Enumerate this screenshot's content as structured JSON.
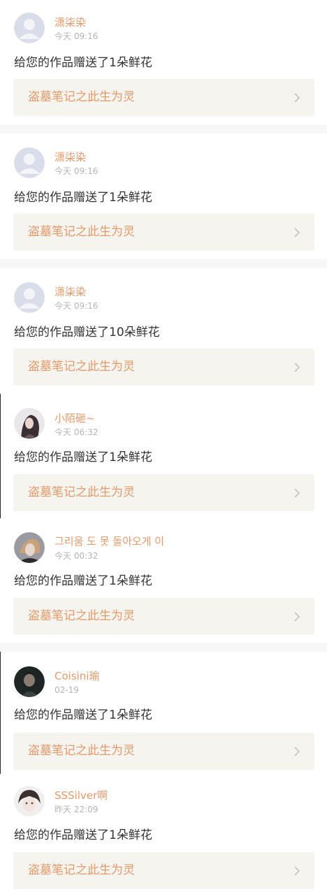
{
  "feed": [
    {
      "user": "潇柒染",
      "time": "今天 09:16",
      "message": "给您的作品赠送了1朵鲜花",
      "work_title": "盗墓笔记之此生为灵",
      "avatar": "default-avatar-icon"
    },
    {
      "user": "潇柒染",
      "time": "今天 09:16",
      "message": "给您的作品赠送了1朵鲜花",
      "work_title": "盗墓笔记之此生为灵",
      "avatar": "default-avatar-icon"
    },
    {
      "user": "潇柒染",
      "time": "今天 09:16",
      "message": "给您的作品赠送了10朵鲜花",
      "work_title": "盗墓笔记之此生为灵",
      "avatar": "default-avatar-icon"
    },
    {
      "user": "小陌砸~",
      "time": "今天 06:32",
      "message": "给您的作品赠送了1朵鲜花",
      "work_title": "盗墓笔记之此生为灵",
      "avatar": "user-photo"
    },
    {
      "user": "그리움 도 못 돌아오게 이",
      "time": "今天 00:32",
      "message": "给您的作品赠送了1朵鲜花",
      "work_title": "盗墓笔记之此生为灵",
      "avatar": "user-photo"
    },
    {
      "user": "Coisini瑜",
      "time": "02-19",
      "message": "给您的作品赠送了1朵鲜花",
      "work_title": "盗墓笔记之此生为灵",
      "avatar": "user-photo"
    },
    {
      "user": "SSSilver啊",
      "time": "昨天 22:09",
      "message": "给您的作品赠送了1朵鲜花",
      "work_title": "盗墓笔记之此生为灵",
      "avatar": "user-photo"
    }
  ],
  "colors": {
    "accent": "#e8996a",
    "link_bg": "#f5f4ee",
    "divider_bg": "#f7f7f7",
    "time_text": "#b5b5b5",
    "body_text": "#333333"
  }
}
